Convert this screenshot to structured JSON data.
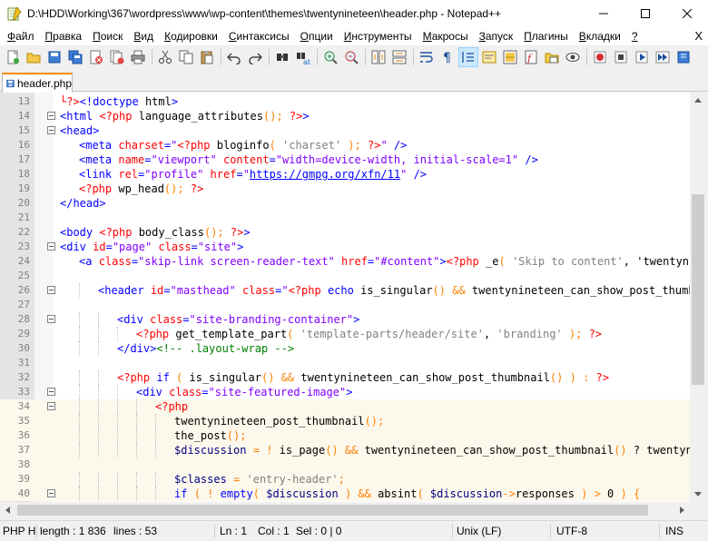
{
  "window": {
    "title": "D:\\HDD\\Working\\367\\wordpress\\www\\wp-content\\themes\\twentynineteen\\header.php - Notepad++",
    "minimize_glyph": "—",
    "maximize_glyph": "☐",
    "close_glyph": "✕"
  },
  "menu": {
    "items": [
      {
        "mnemonic": "Ф",
        "rest": "айл"
      },
      {
        "mnemonic": "П",
        "rest": "равка"
      },
      {
        "mnemonic": "П",
        "rest": "оиск"
      },
      {
        "mnemonic": "В",
        "rest": "ид"
      },
      {
        "mnemonic": "К",
        "rest": "одировки"
      },
      {
        "mnemonic": "С",
        "rest": "интаксисы"
      },
      {
        "mnemonic": "О",
        "rest": "пции"
      },
      {
        "mnemonic": "И",
        "rest": "нструменты"
      },
      {
        "mnemonic": "М",
        "rest": "акросы"
      },
      {
        "mnemonic": "З",
        "rest": "апуск"
      },
      {
        "mnemonic": "П",
        "rest": "лагины"
      },
      {
        "mnemonic": "В",
        "rest": "кладки"
      },
      {
        "mnemonic": "?",
        "rest": ""
      }
    ],
    "close_glyph": "X"
  },
  "toolbar": {
    "buttons": [
      "new-file-icon",
      "open-file-icon",
      "save-icon",
      "save-all-icon",
      "close-icon",
      "close-all-icon",
      "print-icon",
      "sep",
      "cut-icon",
      "copy-icon",
      "paste-icon",
      "sep",
      "undo-icon",
      "redo-icon",
      "sep",
      "find-icon",
      "replace-icon",
      "sep",
      "zoom-in-icon",
      "zoom-out-icon",
      "sep",
      "sync-vertical-icon",
      "sync-horizontal-icon",
      "sep",
      "word-wrap-icon",
      "show-all-chars-icon",
      "indent-guide-icon",
      "udl-icon",
      "doc-map-icon",
      "function-list-icon",
      "folder-workspace-icon",
      "monitoring-icon",
      "sep",
      "record-macro-icon",
      "stop-macro-icon",
      "play-macro-icon",
      "play-macro-multiple-icon",
      "save-macro-icon"
    ],
    "active": "indent-guide-icon"
  },
  "tab": {
    "label": "header.php"
  },
  "editor": {
    "lines": [
      {
        "n": "13",
        "fold": false,
        "indent": 0,
        "hl": false,
        "text": "└?><!doctype html>"
      },
      {
        "n": "14",
        "fold": true,
        "indent": 0,
        "hl": false,
        "text": "<html <?php language_attributes(); ?>>"
      },
      {
        "n": "15",
        "fold": true,
        "indent": 0,
        "hl": false,
        "text": "<head>"
      },
      {
        "n": "16",
        "fold": false,
        "indent": 1,
        "hl": false,
        "text": "<meta charset=\"<?php bloginfo( 'charset' ); ?>\" />"
      },
      {
        "n": "17",
        "fold": false,
        "indent": 1,
        "hl": false,
        "text": "<meta name=\"viewport\" content=\"width=device-width, initial-scale=1\" />"
      },
      {
        "n": "18",
        "fold": false,
        "indent": 1,
        "hl": false,
        "text": "<link rel=\"profile\" href=\"https://gmpg.org/xfn/11\" />"
      },
      {
        "n": "19",
        "fold": false,
        "indent": 1,
        "hl": false,
        "text": "<?php wp_head(); ?>"
      },
      {
        "n": "20",
        "fold": false,
        "indent": 0,
        "hl": false,
        "text": "</head>"
      },
      {
        "n": "21",
        "fold": false,
        "indent": 0,
        "hl": false,
        "text": ""
      },
      {
        "n": "22",
        "fold": false,
        "indent": 0,
        "hl": false,
        "text": "<body <?php body_class(); ?>>"
      },
      {
        "n": "23",
        "fold": true,
        "indent": 0,
        "hl": false,
        "text": "<div id=\"page\" class=\"site\">"
      },
      {
        "n": "24",
        "fold": false,
        "indent": 1,
        "hl": false,
        "text": "<a class=\"skip-link screen-reader-text\" href=\"#content\"><?php _e( 'Skip to content', 'twentynine"
      },
      {
        "n": "25",
        "fold": false,
        "indent": 0,
        "hl": false,
        "text": ""
      },
      {
        "n": "26",
        "fold": true,
        "indent": 2,
        "hl": false,
        "text": "<header id=\"masthead\" class=\"<?php echo is_singular() && twentynineteen_can_show_post_thumbna"
      },
      {
        "n": "27",
        "fold": false,
        "indent": 0,
        "hl": false,
        "text": ""
      },
      {
        "n": "28",
        "fold": true,
        "indent": 3,
        "hl": false,
        "text": "<div class=\"site-branding-container\">"
      },
      {
        "n": "29",
        "fold": false,
        "indent": 4,
        "hl": false,
        "text": "<?php get_template_part( 'template-parts/header/site', 'branding' ); ?>"
      },
      {
        "n": "30",
        "fold": false,
        "indent": 3,
        "hl": false,
        "text": "</div><!-- .layout-wrap -->"
      },
      {
        "n": "31",
        "fold": false,
        "indent": 0,
        "hl": false,
        "text": ""
      },
      {
        "n": "32",
        "fold": false,
        "indent": 3,
        "hl": false,
        "text": "<?php if ( is_singular() && twentynineteen_can_show_post_thumbnail() ) : ?>"
      },
      {
        "n": "33",
        "fold": true,
        "indent": 4,
        "hl": false,
        "text": "<div class=\"site-featured-image\">"
      },
      {
        "n": "34",
        "fold": true,
        "indent": 5,
        "hl": true,
        "text": "<?php"
      },
      {
        "n": "35",
        "fold": false,
        "indent": 6,
        "hl": true,
        "text": "twentynineteen_post_thumbnail();"
      },
      {
        "n": "36",
        "fold": false,
        "indent": 6,
        "hl": true,
        "text": "the_post();"
      },
      {
        "n": "37",
        "fold": false,
        "indent": 6,
        "hl": true,
        "text": "$discussion = ! is_page() && twentynineteen_can_show_post_thumbnail() ? twentynin"
      },
      {
        "n": "38",
        "fold": false,
        "indent": 0,
        "hl": true,
        "text": ""
      },
      {
        "n": "39",
        "fold": false,
        "indent": 6,
        "hl": true,
        "text": "$classes = 'entry-header';"
      },
      {
        "n": "40",
        "fold": true,
        "indent": 6,
        "hl": true,
        "text": "if ( ! empty( $discussion ) && absint( $discussion->responses ) > 0 ) {"
      }
    ]
  },
  "status": {
    "lang": "PHP H",
    "length": "length : 1 836",
    "lines": "lines : 53",
    "ln": "Ln : 1",
    "col": "Col : 1",
    "sel": "Sel : 0 | 0",
    "eol": "Unix (LF)",
    "encoding": "UTF-8",
    "mode": "INS"
  },
  "colors": {
    "tab_accent": "#fa8c00",
    "line_highlight": "#fdf8ec",
    "gutter": "#e4e4e4"
  }
}
